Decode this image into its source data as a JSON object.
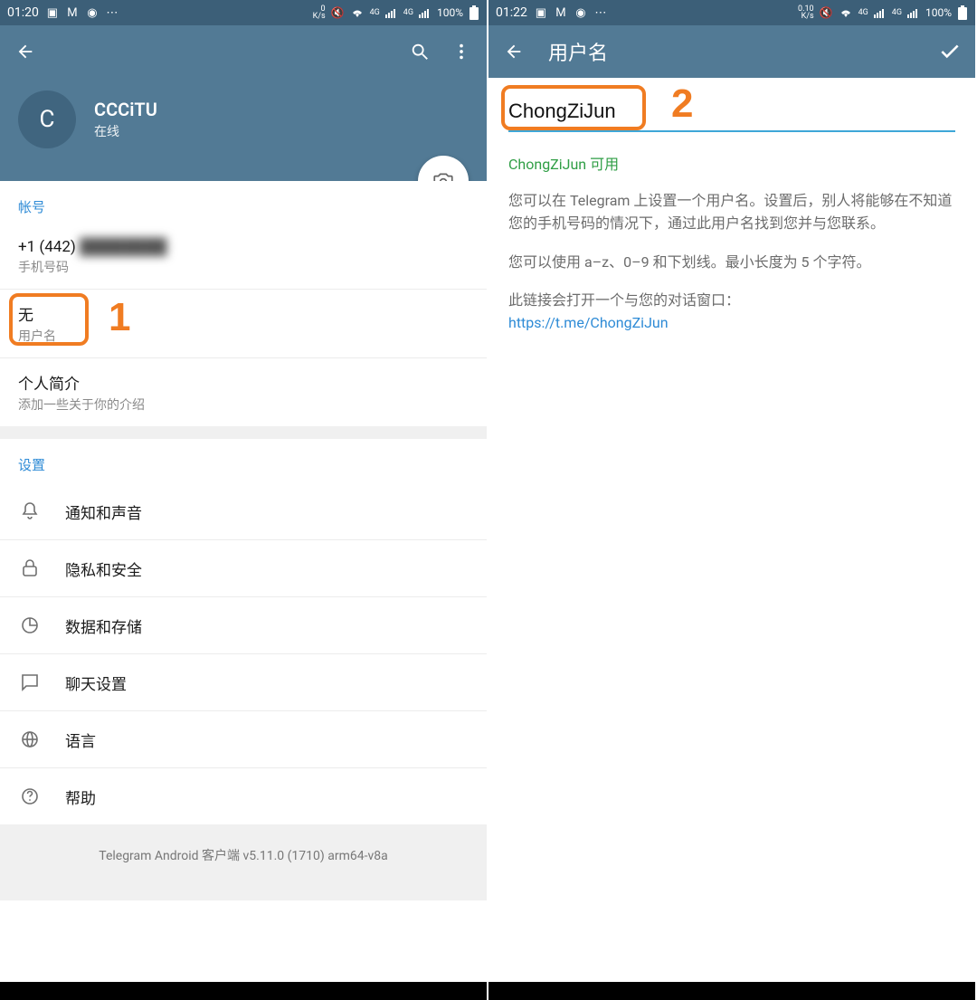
{
  "left": {
    "status": {
      "time": "01:20",
      "net": "0\nK/s",
      "battery": "100%"
    },
    "profile": {
      "avatarLetter": "C",
      "name": "CCCiTU",
      "status": "在线"
    },
    "account": {
      "title": "帐号",
      "phoneVisible": "+1 (442) ",
      "phoneLabel": "手机号码",
      "usernameValue": "无",
      "usernameLabel": "用户名",
      "bioTitle": "个人简介",
      "bioHint": "添加一些关于你的介绍"
    },
    "settings": {
      "title": "设置",
      "items": [
        "通知和声音",
        "隐私和安全",
        "数据和存储",
        "聊天设置",
        "语言",
        "帮助"
      ]
    },
    "footer": "Telegram Android 客户端 v5.11.0 (1710) arm64-v8a",
    "annotation": "1"
  },
  "right": {
    "status": {
      "time": "01:22",
      "net": "0.10\nK/s",
      "battery": "100%"
    },
    "appbarTitle": "用户名",
    "inputValue": "ChongZiJun",
    "availText": "ChongZiJun 可用",
    "para1": "您可以在 Telegram 上设置一个用户名。设置后，别人将能够在不知道您的手机号码的情况下，通过此用户名找到您并与您联系。",
    "para2": "您可以使用 a–z、0–9 和下划线。最小长度为 5 个字符。",
    "para3": "此链接会打开一个与您的对话窗口：",
    "link": "https://t.me/ChongZiJun",
    "annotation": "2"
  }
}
